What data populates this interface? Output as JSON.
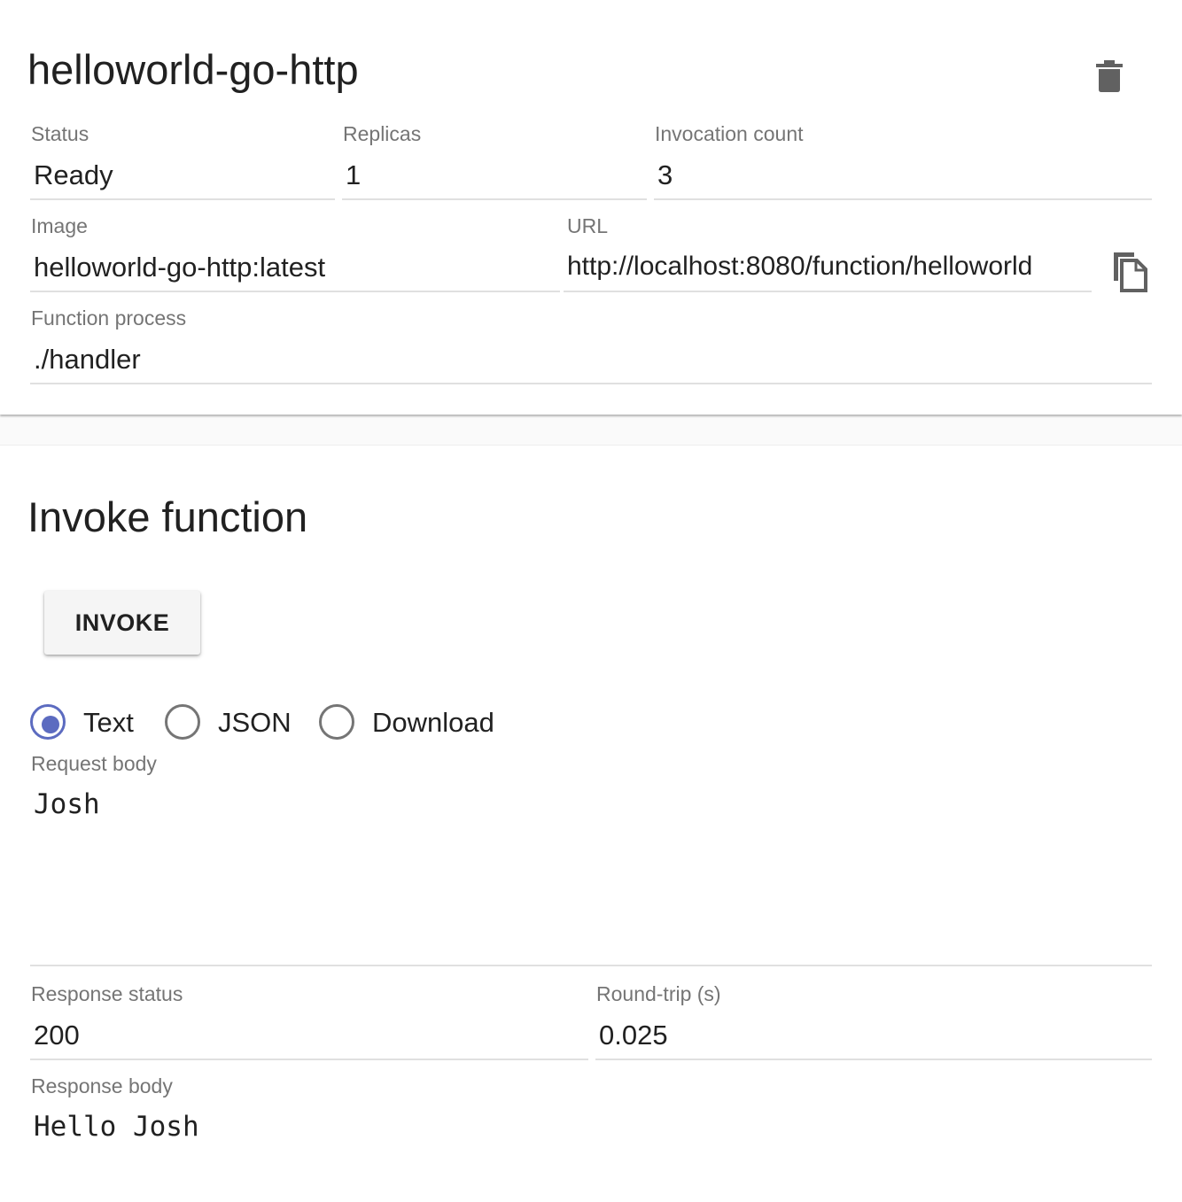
{
  "details": {
    "function_name": "helloworld-go-http",
    "delete_icon": "trash-icon",
    "status": {
      "label": "Status",
      "value": "Ready"
    },
    "replicas": {
      "label": "Replicas",
      "value": "1"
    },
    "invocation_count": {
      "label": "Invocation count",
      "value": "3"
    },
    "image": {
      "label": "Image",
      "value": "helloworld-go-http:latest"
    },
    "url": {
      "label": "URL",
      "value": "http://localhost:8080/function/helloworld",
      "copy_icon": "copy-icon"
    },
    "function_process": {
      "label": "Function process",
      "value": "./handler"
    }
  },
  "invoke": {
    "title": "Invoke function",
    "invoke_button": "INVOKE",
    "modes": [
      {
        "label": "Text",
        "selected": true
      },
      {
        "label": "JSON",
        "selected": false
      },
      {
        "label": "Download",
        "selected": false
      }
    ],
    "request_body": {
      "label": "Request body",
      "value": "Josh"
    },
    "response_status": {
      "label": "Response status",
      "value": "200"
    },
    "round_trip": {
      "label": "Round-trip (s)",
      "value": "0.025"
    },
    "response_body": {
      "label": "Response body",
      "value": "Hello Josh"
    }
  },
  "colors": {
    "accent": "#5c6bc0",
    "icon": "#616161",
    "label": "#757575",
    "underline": "#e0e0e0"
  }
}
